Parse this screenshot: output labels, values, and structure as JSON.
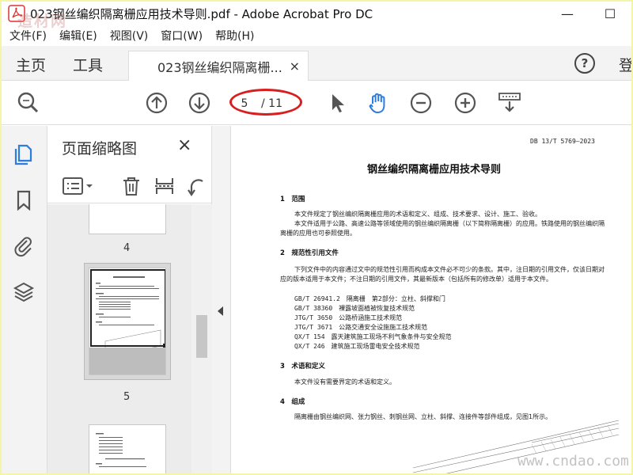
{
  "window": {
    "title": "023钢丝编织隔离栅应用技术导则.pdf - Adobe Acrobat Pro DC",
    "minimize_label": "—",
    "maximize_label": "☐"
  },
  "menu": [
    "文件(F)",
    "编辑(E)",
    "视图(V)",
    "窗口(W)",
    "帮助(H)"
  ],
  "tabs": {
    "home": "主页",
    "tools": "工具",
    "document_tab": "023钢丝编织隔离栅...",
    "close_glyph": "×",
    "help_glyph": "?",
    "login": "登"
  },
  "toolbar": {
    "current_page": "5",
    "total_pages": "/ 11"
  },
  "thumbnails": {
    "title": "页面缩略图",
    "close_glyph": "×",
    "pages": [
      {
        "label": "4"
      },
      {
        "label": "5"
      }
    ]
  },
  "document": {
    "standard_no": "DB 13/T 5769—2023",
    "title": "钢丝编织隔离栅应用技术导则",
    "sections": {
      "s1_heading": "1　范围",
      "s1_p1": "本文件规定了钢丝编织隔离栅应用的术语和定义、组成、技术要求、设计、施工、验收。",
      "s1_p2": "本文件适用于公路、高速公路等领域使用的钢丝编织隔离栅（以下简称隔离栅）的应用。铁路使用的钢丝编织隔离栅的应用也可参照使用。",
      "s2_heading": "2　规范性引用文件",
      "s2_p1": "下列文件中的内容通过文中的规范性引用而构成本文件必不可少的条款。其中，注日期的引用文件，仅该日期对应的版本适用于本文件；不注日期的引用文件，其最新版本（包括所有的修改单）适用于本文件。",
      "refs": [
        {
          "code": "GB/T 26941.2",
          "name": "隔离栅　第2部分：立柱、斜撑和门"
        },
        {
          "code": "GB/T 38360",
          "name": "裸露坡面植被恢复技术规范"
        },
        {
          "code": "JTG/T 3650",
          "name": "公路桥涵施工技术规范"
        },
        {
          "code": "JTG/T 3671",
          "name": "公路交通安全设施施工技术规范"
        },
        {
          "code": "QX/T 154",
          "name": "露天建筑施工现场不利气象条件与安全规范"
        },
        {
          "code": "QX/T 246",
          "name": "建筑施工现场雷电安全技术规范"
        }
      ],
      "s3_heading": "3　术语和定义",
      "s3_p1": "本文件没有需要界定的术语和定义。",
      "s4_heading": "4　组成",
      "s4_p1": "隔离栅由钢丝编织网、张力钢丝、刺钢丝网、立柱、斜撑、连接件等部件组成，见图1所示。"
    }
  },
  "watermarks": {
    "top_left": "造材网",
    "bottom_right": "www.cndao.com"
  },
  "colors": {
    "highlight_ellipse": "#d81e1e",
    "hand_tool_active": "#2b7de1",
    "rail_active_icon": "#2b7de1"
  }
}
